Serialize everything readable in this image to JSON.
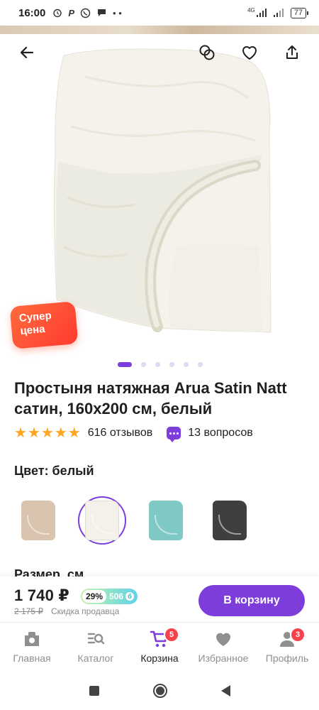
{
  "status_bar": {
    "time": "16:00",
    "network": "4G",
    "battery": "77"
  },
  "product": {
    "title": "Простыня натяжная Arua Satin Natt сатин, 160x200 см, белый",
    "promo_badge": "Супер цена",
    "rating_stars": 5,
    "reviews": "616 отзывов",
    "questions": "13 вопросов",
    "gallery": {
      "count": 6,
      "active_index": 0
    }
  },
  "color": {
    "label": "Цвет: белый",
    "options": [
      {
        "name": "beige",
        "color": "#d9c4b0",
        "selected": false
      },
      {
        "name": "white",
        "color": "#f3f1ea",
        "selected": true
      },
      {
        "name": "teal",
        "color": "#7fc9c4",
        "selected": false
      },
      {
        "name": "graphite",
        "color": "#3f3f42",
        "selected": false
      }
    ]
  },
  "size": {
    "label": "Размер, см"
  },
  "buy_bar": {
    "price": "1 740 ₽",
    "discount_percent": "29%",
    "bonus": "506",
    "bonus_icon": "б",
    "old_price": "2 175 ₽",
    "seller_discount": "Скидка продавца",
    "cart_button": "В корзину"
  },
  "nav": {
    "items": [
      {
        "label": "Главная",
        "icon": "home-icon"
      },
      {
        "label": "Каталог",
        "icon": "catalog-icon"
      },
      {
        "label": "Корзина",
        "icon": "cart-icon",
        "badge": "5",
        "active": true
      },
      {
        "label": "Избранное",
        "icon": "heart-icon"
      },
      {
        "label": "Профиль",
        "icon": "profile-icon",
        "badge": "3"
      }
    ]
  },
  "colors": {
    "accent": "#7d3ddb",
    "star": "#ffa51f",
    "badge": "#f5424b",
    "promo": "#ff4a34"
  }
}
